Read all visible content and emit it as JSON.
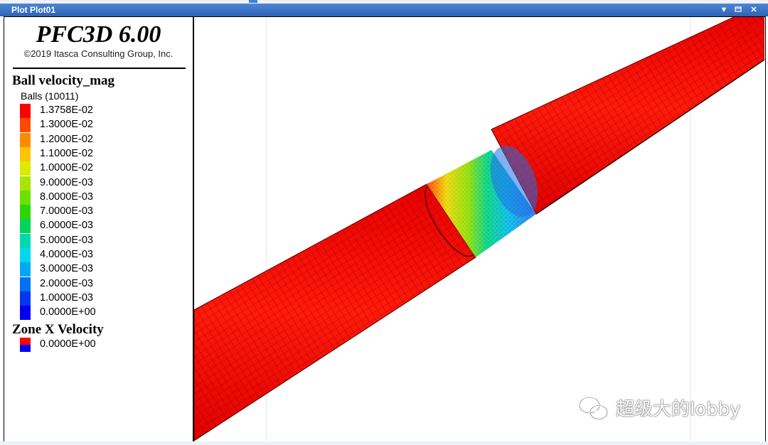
{
  "window": {
    "title": "Plot Plot01",
    "controls": [
      "menu-down-icon",
      "restore-icon",
      "close-icon"
    ]
  },
  "legend": {
    "app_title": "PFC3D 6.00",
    "copyright": "©2019 Itasca Consulting Group, Inc.",
    "ball_section": {
      "title": "Ball velocity_mag",
      "subtitle": "Balls (10011)",
      "entries": [
        {
          "color": "#ff0000",
          "label": "1.3758E-02"
        },
        {
          "color": "#ff4a00",
          "label": "1.3000E-02"
        },
        {
          "color": "#ff8a00",
          "label": "1.2000E-02"
        },
        {
          "color": "#ffc400",
          "label": "1.1000E-02"
        },
        {
          "color": "#dcea00",
          "label": "1.0000E-02"
        },
        {
          "color": "#a8e600",
          "label": "9.0000E-03"
        },
        {
          "color": "#6ee000",
          "label": "8.0000E-03"
        },
        {
          "color": "#2ed600",
          "label": "7.0000E-03"
        },
        {
          "color": "#00d45a",
          "label": "6.0000E-03"
        },
        {
          "color": "#00d8b0",
          "label": "5.0000E-03"
        },
        {
          "color": "#00d8f0",
          "label": "4.0000E-03"
        },
        {
          "color": "#00a8f4",
          "label": "3.0000E-03"
        },
        {
          "color": "#0070f4",
          "label": "2.0000E-03"
        },
        {
          "color": "#0038f0",
          "label": "1.0000E-03"
        },
        {
          "color": "#0000ee",
          "label": "0.0000E+00"
        }
      ]
    },
    "zone_section": {
      "title": "Zone X Velocity",
      "entries": [
        {
          "colors": [
            "#ff0000",
            "#0000ee"
          ],
          "label": "0.0000E+00"
        }
      ]
    }
  },
  "viewport": {
    "model_color": "#ff0000",
    "ball_gradient": [
      "#ff3a00",
      "#e8d000",
      "#7ed800",
      "#00d080",
      "#00b8e8",
      "#1e6ee8"
    ]
  },
  "watermark": {
    "text": "超级大的lobby",
    "icon": "wechat-icon"
  }
}
